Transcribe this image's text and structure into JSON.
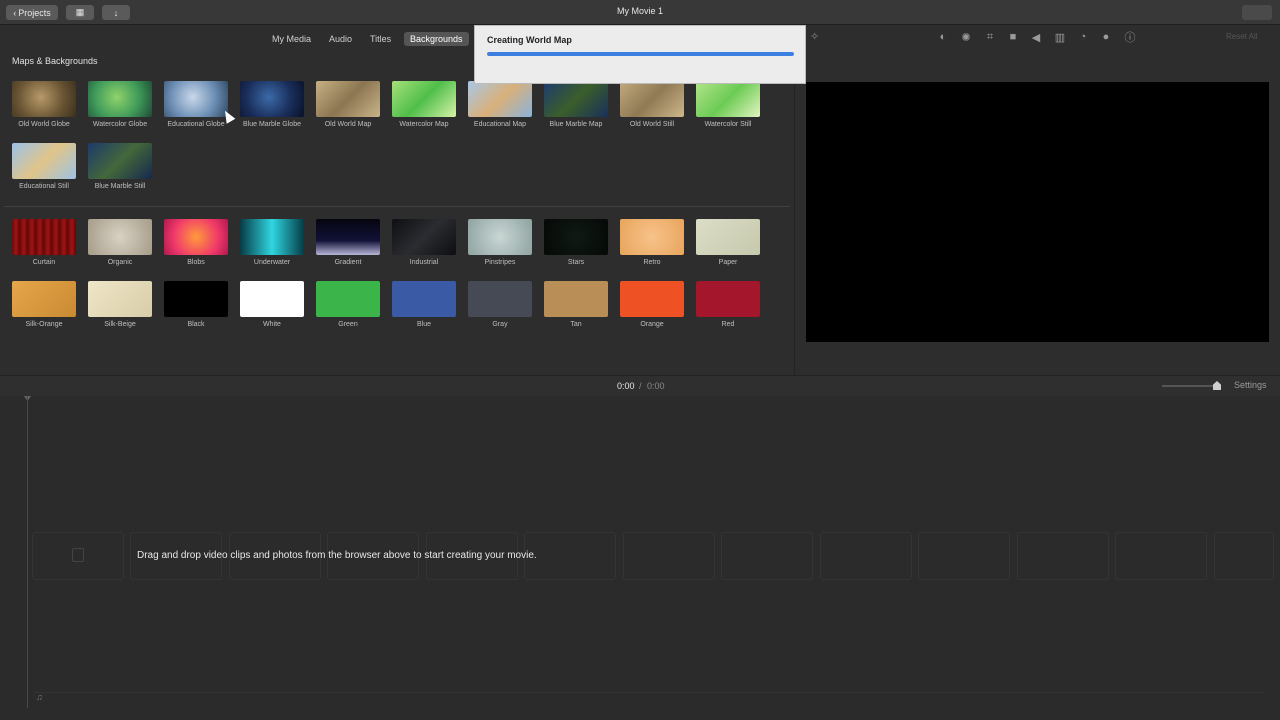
{
  "window": {
    "title": "My Movie 1",
    "projects_label": "Projects"
  },
  "tabs": [
    {
      "label": "My Media",
      "active": false
    },
    {
      "label": "Audio",
      "active": false
    },
    {
      "label": "Titles",
      "active": false
    },
    {
      "label": "Backgrounds",
      "active": true
    }
  ],
  "toolbar": {
    "reset_all": "Reset All"
  },
  "maps": {
    "title": "Maps & Backgrounds",
    "items": [
      {
        "label": "Old World Globe",
        "style": "radial-gradient(circle at 45% 45%, #b89a6a 0%, #6b5634 55%, #3a2f1e 100%)"
      },
      {
        "label": "Watercolor Globe",
        "style": "radial-gradient(circle at 45% 45%, #8fd36b 0%, #3f9a5a 55%, #1f4a35 100%)"
      },
      {
        "label": "Educational Globe",
        "style": "radial-gradient(circle at 45% 45%, #c9d8ea 0%, #6d8fb5 55%, #2d4660 100%)"
      },
      {
        "label": "Blue Marble Globe",
        "style": "radial-gradient(circle at 45% 45%, #3c6aa8 0%, #1a2f5c 55%, #0a1026 100%)"
      },
      {
        "label": "Old World Map",
        "style": "linear-gradient(135deg, #c7b083, #8b7652 50%, #c9b489)"
      },
      {
        "label": "Watercolor Map",
        "style": "linear-gradient(135deg, #a6e07a, #4fbf4a 50%, #d9f2a8)"
      },
      {
        "label": "Educational Map",
        "style": "linear-gradient(135deg, #a8c8e8, #d9b07a 50%, #8ab4dd)"
      },
      {
        "label": "Blue Marble Map",
        "style": "linear-gradient(135deg, #1d3c6e, #3b5e2a 50%, #1a2f5c)"
      },
      {
        "label": "Old World Still",
        "style": "linear-gradient(135deg, #c2aa7c, #8f7a55 50%, #cdb78a)"
      },
      {
        "label": "Watercolor Still",
        "style": "linear-gradient(135deg, #b3e58a, #6ccb55 50%, #e3f4c0)"
      },
      {
        "label": "Educational Still",
        "style": "linear-gradient(135deg, #9cc2e8, #e0c48a 50%, #9dc3e6)"
      },
      {
        "label": "Blue Marble Still",
        "style": "linear-gradient(135deg, #1c3a6b, #44683a 50%, #16284e)"
      }
    ]
  },
  "backgrounds": {
    "items": [
      {
        "label": "Curtain",
        "style": "repeating-linear-gradient(90deg, #6e0a0a 0px, #a01414 4px, #5a0707 8px)"
      },
      {
        "label": "Organic",
        "style": "radial-gradient(circle, #d8d2c4, #a59b88)"
      },
      {
        "label": "Blobs",
        "style": "radial-gradient(circle at 50% 50%, #ff9a3c 0%, #f03a6a 60%, #b01850 100%)"
      },
      {
        "label": "Underwater",
        "style": "linear-gradient(90deg, #063c46, #2fd6e0 50%, #063c46)"
      },
      {
        "label": "Gradient",
        "style": "linear-gradient(180deg, #05050f 0%, #121238 60%, #b9b7d8 100%)"
      },
      {
        "label": "Industrial",
        "style": "linear-gradient(135deg, #0e0f12, #2a2c31 50%, #0d0e10)"
      },
      {
        "label": "Pinstripes",
        "style": "radial-gradient(circle, #c9d6d4, #8ea3a1)"
      },
      {
        "label": "Stars",
        "style": "radial-gradient(circle, #101a14, #050806)"
      },
      {
        "label": "Retro",
        "style": "radial-gradient(circle, #f7c28a, #e8a55c)"
      },
      {
        "label": "Paper",
        "style": "linear-gradient(135deg, #dcddc7, #c7c9ad)"
      },
      {
        "label": "Silk-Orange",
        "style": "linear-gradient(135deg, #e6a64a, #c98a32)"
      },
      {
        "label": "Silk-Beige",
        "style": "linear-gradient(135deg, #efe6c8, #d8cda8)"
      },
      {
        "label": "Black",
        "style": "#000000"
      },
      {
        "label": "White",
        "style": "#ffffff"
      },
      {
        "label": "Green",
        "style": "#3bb44a"
      },
      {
        "label": "Blue",
        "style": "#3a5aa6"
      },
      {
        "label": "Gray",
        "style": "#454a55"
      },
      {
        "label": "Tan",
        "style": "#b98e57"
      },
      {
        "label": "Orange",
        "style": "#ee5124"
      },
      {
        "label": "Red",
        "style": "#a3162c"
      }
    ]
  },
  "timeline": {
    "current_time": "0:00",
    "separator": "/",
    "total_time": "0:00",
    "settings_label": "Settings",
    "hint": "Drag and drop video clips and photos from the browser above to start creating your movie."
  },
  "popup": {
    "title": "Creating World Map",
    "progress": 1.0
  },
  "colors": {
    "accent": "#3b7fe0"
  }
}
